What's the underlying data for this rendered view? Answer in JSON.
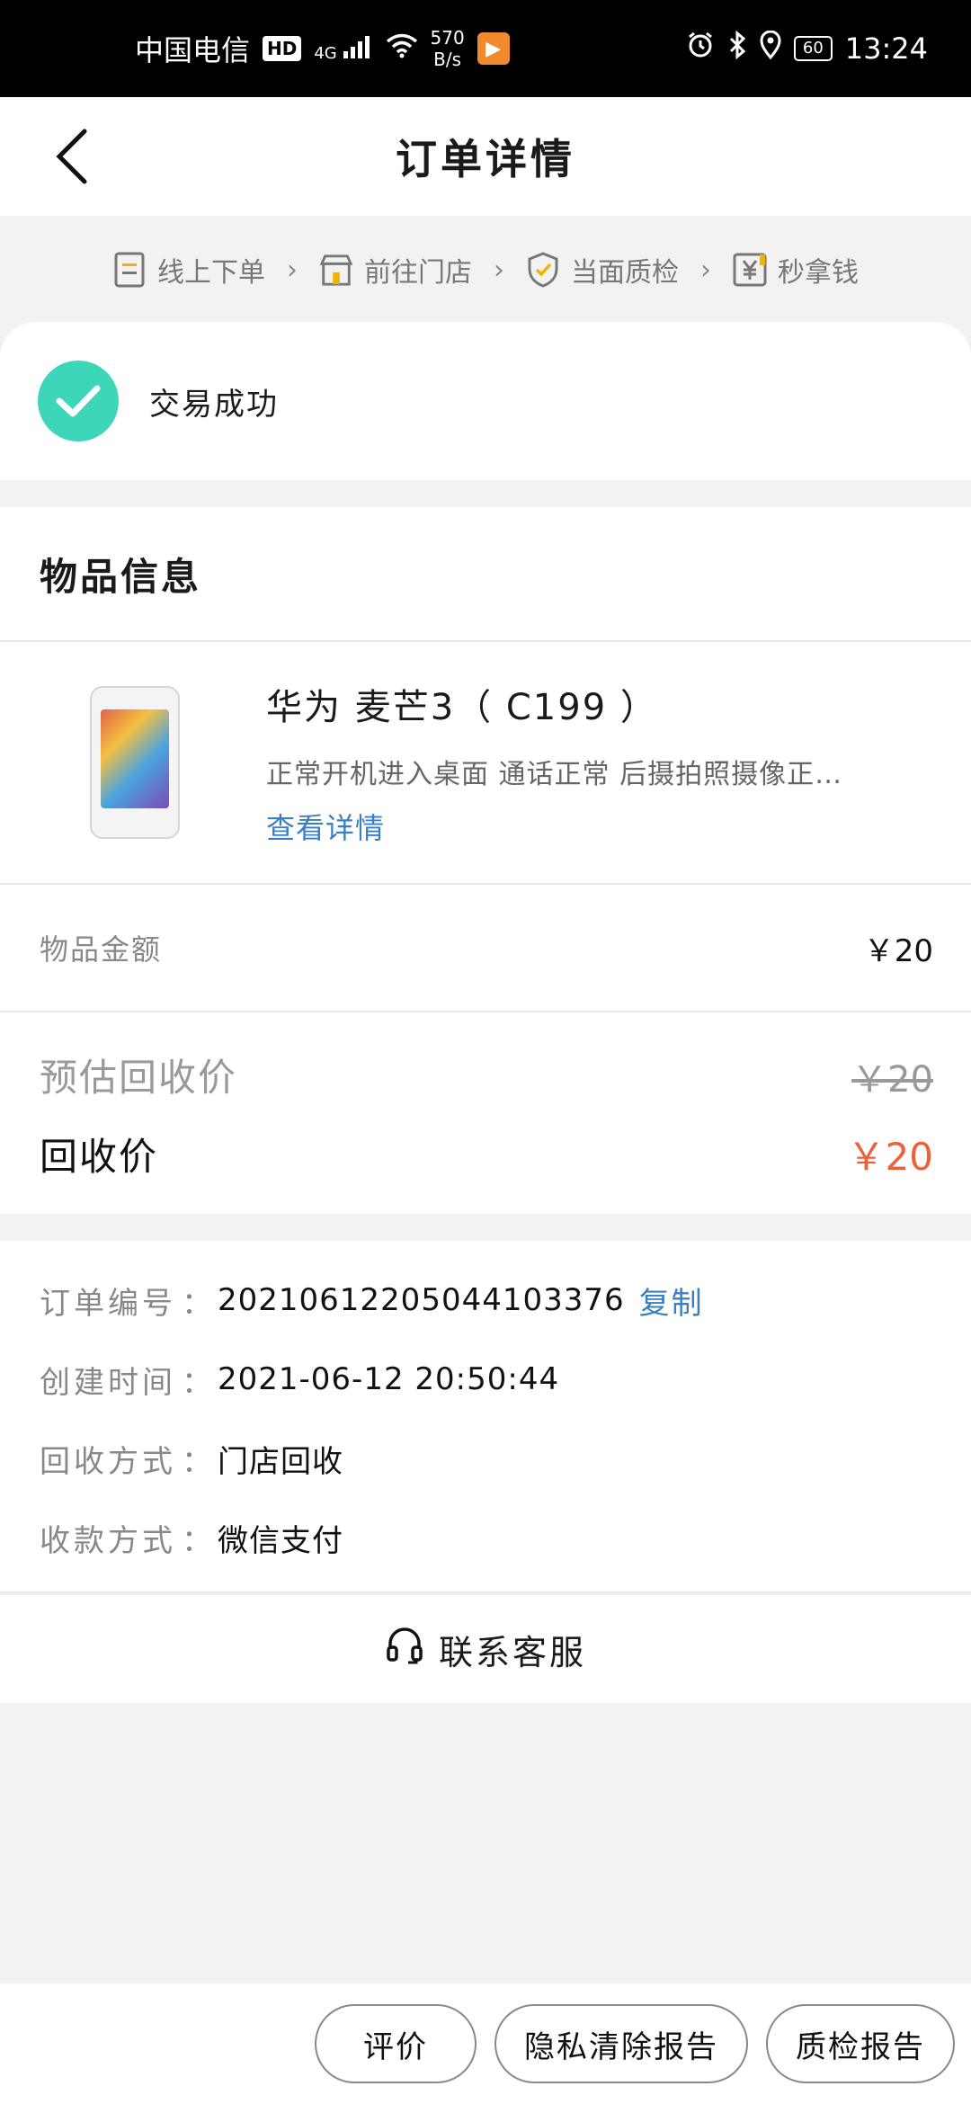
{
  "status_bar": {
    "carrier": "中国电信",
    "hd": "HD",
    "network": "4G",
    "speed_value": "570",
    "speed_unit": "B/s",
    "battery": "60",
    "time": "13:24"
  },
  "header": {
    "title": "订单详情"
  },
  "steps": [
    {
      "label": "线上下单",
      "icon": "order-form-icon"
    },
    {
      "label": "前往门店",
      "icon": "store-icon"
    },
    {
      "label": "当面质检",
      "icon": "shield-check-icon"
    },
    {
      "label": "秒拿钱",
      "icon": "yen-icon"
    }
  ],
  "status": {
    "text": "交易成功",
    "color": "#3ed6b8"
  },
  "item": {
    "section_title": "物品信息",
    "name": "华为 麦芒3（ C199 ）",
    "description": "正常开机进入桌面 通话正常 后摄拍照摄像正…",
    "detail_link": "查看详情",
    "amount_label": "物品金额",
    "amount_value": "￥20",
    "estimated_label": "预估回收价",
    "estimated_value": "￥20",
    "final_label": "回收价",
    "final_value": "￥20",
    "accent_color": "#e8623a"
  },
  "order": {
    "number_label": "订单编号",
    "number_value": "20210612205044103376",
    "copy_label": "复制",
    "created_label": "创建时间",
    "created_value": "2021-06-12 20:50:44",
    "method_label": "回收方式",
    "method_value": "门店回收",
    "payment_label": "收款方式",
    "payment_value": "微信支付",
    "colon": "："
  },
  "support": {
    "label": "联系客服"
  },
  "bottom": {
    "review": "评价",
    "privacy_report": "隐私清除报告",
    "quality_report": "质检报告"
  }
}
